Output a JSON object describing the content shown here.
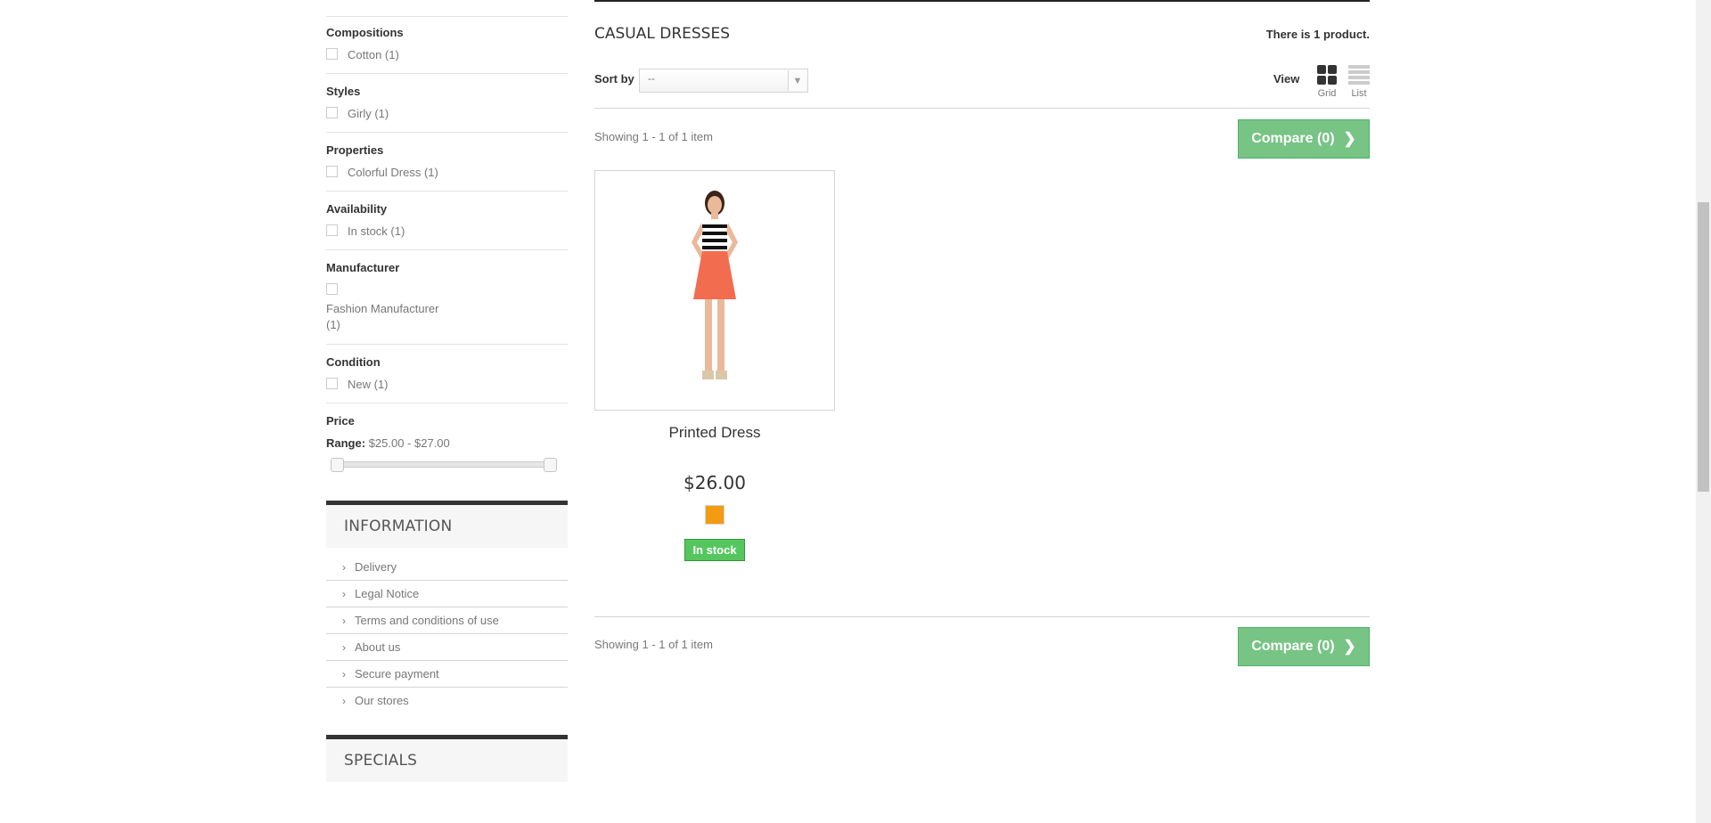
{
  "filters": {
    "facets": [
      {
        "title": "Compositions",
        "label": "Cotton (1)"
      },
      {
        "title": "Styles",
        "label": "Girly (1)"
      },
      {
        "title": "Properties",
        "label": "Colorful Dress (1)"
      },
      {
        "title": "Availability",
        "label": "In stock (1)"
      }
    ],
    "manufacturer": {
      "title": "Manufacturer",
      "label_line1": "Fashion Manufacturer",
      "label_line2": "(1)"
    },
    "condition": {
      "title": "Condition",
      "label": "New (1)"
    },
    "price": {
      "title": "Price",
      "range_label": "Range:",
      "range_value": "$25.00 - $27.00",
      "min_fraction": 0.0,
      "max_fraction": 1.0
    }
  },
  "information": {
    "title": "INFORMATION",
    "links": [
      "Delivery",
      "Legal Notice",
      "Terms and conditions of use",
      "About us",
      "Secure payment",
      "Our stores"
    ]
  },
  "specials": {
    "title": "SPECIALS"
  },
  "category": {
    "title": "CASUAL DRESSES",
    "count_text": "There is 1 product.",
    "sort_label": "Sort by",
    "sort_value": "--",
    "view_label": "View",
    "view_grid": "Grid",
    "view_list": "List",
    "showing_top": "Showing 1 - 1 of 1 item",
    "showing_bottom": "Showing 1 - 1 of 1 item",
    "compare_label": "Compare (0)"
  },
  "product": {
    "name": "Printed Dress",
    "price": "$26.00",
    "swatch_color": "#f39c11",
    "availability": "In stock"
  },
  "colors": {
    "compare_green": "#77c485",
    "stock_green": "#55c65e"
  }
}
